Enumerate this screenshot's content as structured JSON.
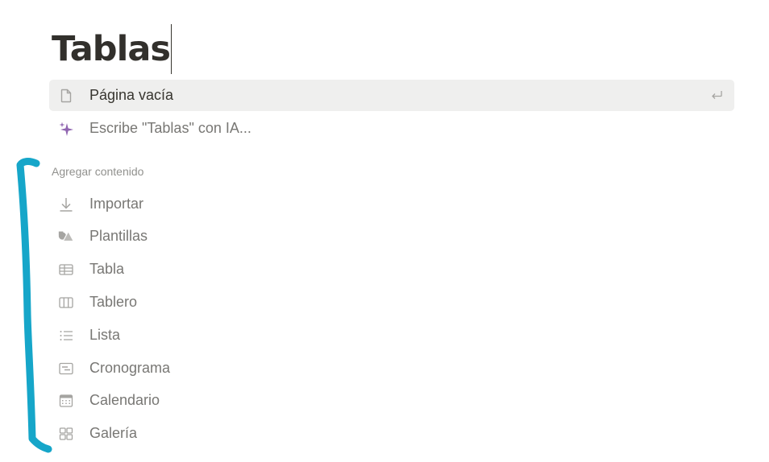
{
  "page": {
    "title": "Tablas"
  },
  "suggestions": [
    {
      "label": "Página vacía",
      "icon": "page-icon",
      "selected": true,
      "shortcut_icon": "enter-icon"
    },
    {
      "label": "Escribe \"Tablas\" con IA...",
      "icon": "ai-sparkle-icon"
    }
  ],
  "add_content": {
    "header": "Agregar contenido",
    "items": [
      {
        "label": "Importar",
        "icon": "import-arrow-icon"
      },
      {
        "label": "Plantillas",
        "icon": "templates-shapes-icon"
      },
      {
        "label": "Tabla",
        "icon": "table-icon"
      },
      {
        "label": "Tablero",
        "icon": "board-icon"
      },
      {
        "label": "Lista",
        "icon": "list-icon"
      },
      {
        "label": "Cronograma",
        "icon": "timeline-icon"
      },
      {
        "label": "Calendario",
        "icon": "calendar-icon"
      },
      {
        "label": "Galería",
        "icon": "gallery-icon"
      }
    ]
  },
  "annotation": {
    "color": "#16a6c9",
    "shape": "hand-drawn bracket"
  },
  "colors": {
    "selected_bg": "#efefee",
    "muted_text": "#787774",
    "icon_gray": "#a5a4a1",
    "ai_purple": "#9065b0"
  }
}
